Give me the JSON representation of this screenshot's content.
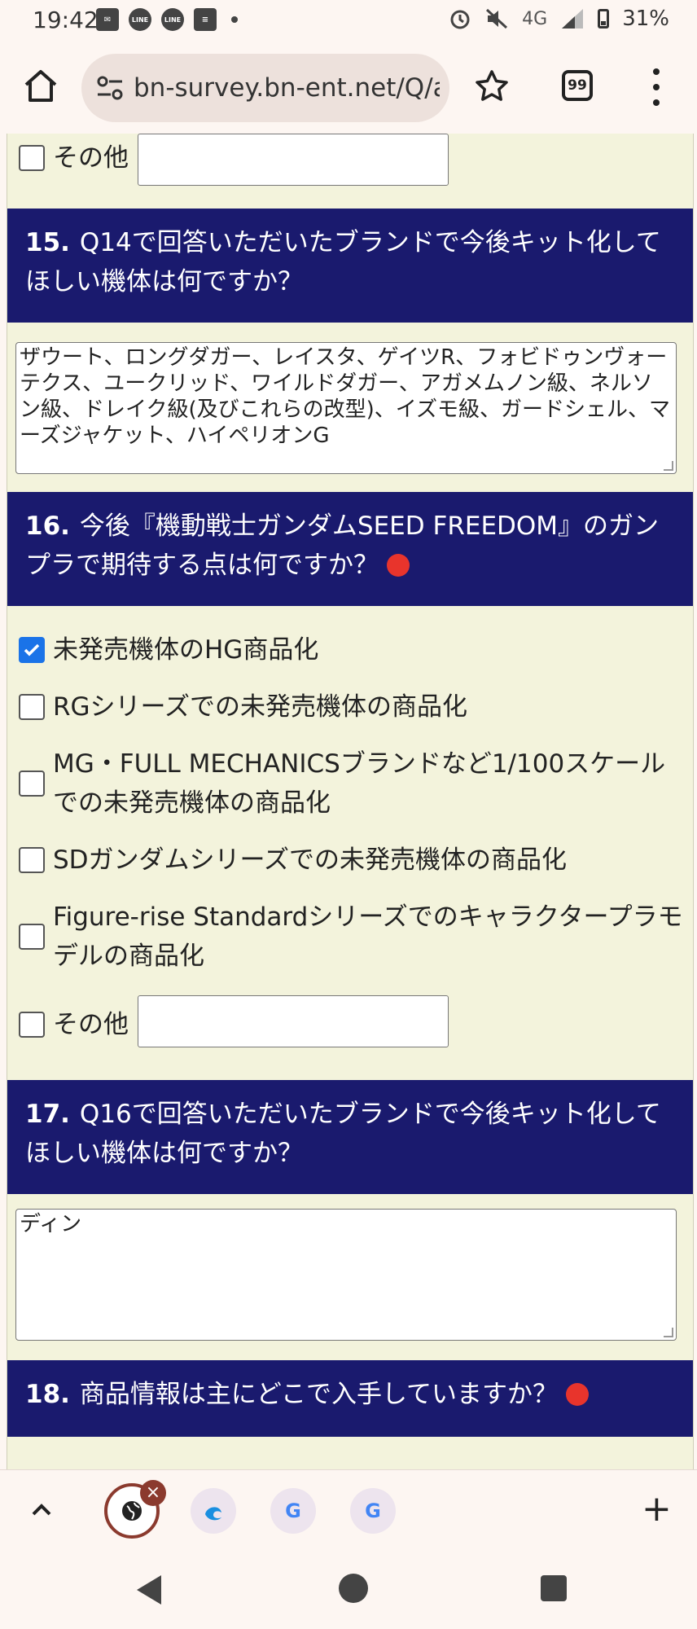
{
  "status_bar": {
    "time": "19:42",
    "network": "4G",
    "battery": "31%",
    "icons": [
      "mail-icon",
      "line-icon",
      "line-icon",
      "news-icon",
      "alarm-icon",
      "mute-icon",
      "signal-icon",
      "battery-icon"
    ],
    "line_label": "LINE"
  },
  "browser": {
    "url": "bn-survey.bn-ent.net/Q/au",
    "tab_count": "99"
  },
  "form": {
    "q14_tail": {
      "other_label": "その他"
    },
    "q15": {
      "number": "15.",
      "text": "Q14で回答いただいたブランドで今後キット化してほしい機体は何ですか？",
      "answer": "ザウート、ロングダガー、レイスタ、ゲイツR、フォビドゥンヴォーテクス、ユークリッド、ワイルドダガー、アガメムノン級、ネルソン級、ドレイク級(及びこれらの改型)、イズモ級、ガードシェル、マーズジャケット、ハイペリオンG"
    },
    "q16": {
      "number": "16.",
      "text": "今後『機動戦士ガンダムSEED FREEDOM』のガンプラで期待する点は何ですか？",
      "options": [
        {
          "label": "未発売機体のHG商品化",
          "checked": true
        },
        {
          "label": "RGシリーズでの未発売機体の商品化",
          "checked": false
        },
        {
          "label": "MG・FULL MECHANICSブランドなど1/100スケールでの未発売機体の商品化",
          "checked": false
        },
        {
          "label": "SDガンダムシリーズでの未発売機体の商品化",
          "checked": false
        },
        {
          "label": "Figure-rise Standardシリーズでのキャラクタープラモデルの商品化",
          "checked": false
        }
      ],
      "other_label": "その他"
    },
    "q17": {
      "number": "17.",
      "text": "Q16で回答いただいたブランドで今後キット化してほしい機体は何ですか？",
      "answer": "ディン"
    },
    "q18": {
      "number": "18.",
      "text": "商品情報は主にどこで入手していますか？"
    },
    "colors": {
      "header": "#1a1a6e",
      "required": "#e8342c",
      "form_bg": "#f3f3dc",
      "checkbox_on": "#1a73e8"
    }
  },
  "bottom_tabs": {
    "favicons": [
      "globe-icon",
      "edge-icon",
      "google-icon",
      "google-icon"
    ],
    "google_letter": "G",
    "close": "×",
    "new_tab": "+"
  }
}
